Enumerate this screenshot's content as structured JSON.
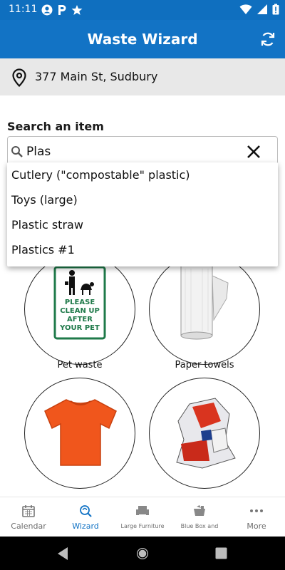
{
  "status_bar": {
    "time": "11:11"
  },
  "app_bar": {
    "title": "Waste Wizard",
    "refresh_icon": "refresh-icon"
  },
  "address": {
    "text": "377 Main St, Sudbury",
    "icon": "location-pin-icon"
  },
  "search": {
    "label": "Search an item",
    "value": "Plas",
    "suggestions": [
      "Cutlery (\"compostable\" plastic)",
      "Toys (large)",
      "Plastic straw",
      "Plastics #1"
    ]
  },
  "tiles": {
    "sign_text": [
      "PLEASE",
      "CLEAN UP",
      "AFTER",
      "YOUR PET"
    ],
    "labels": [
      "Pet waste",
      "Paper towels"
    ]
  },
  "bottom_nav": {
    "items": [
      {
        "label": "Calendar",
        "icon": "calendar-icon"
      },
      {
        "label": "Wizard",
        "icon": "wizard-icon",
        "active": true
      },
      {
        "label": "Large Furniture",
        "icon": "furniture-icon"
      },
      {
        "label": "Blue Box and",
        "icon": "blue-box-icon"
      },
      {
        "label": "More",
        "icon": "more-icon"
      }
    ]
  },
  "colors": {
    "primary": "#1273c5",
    "status_bar": "#0f6fbf",
    "address_bg": "#e8e8e8",
    "inactive_nav": "#6d6d6d"
  }
}
